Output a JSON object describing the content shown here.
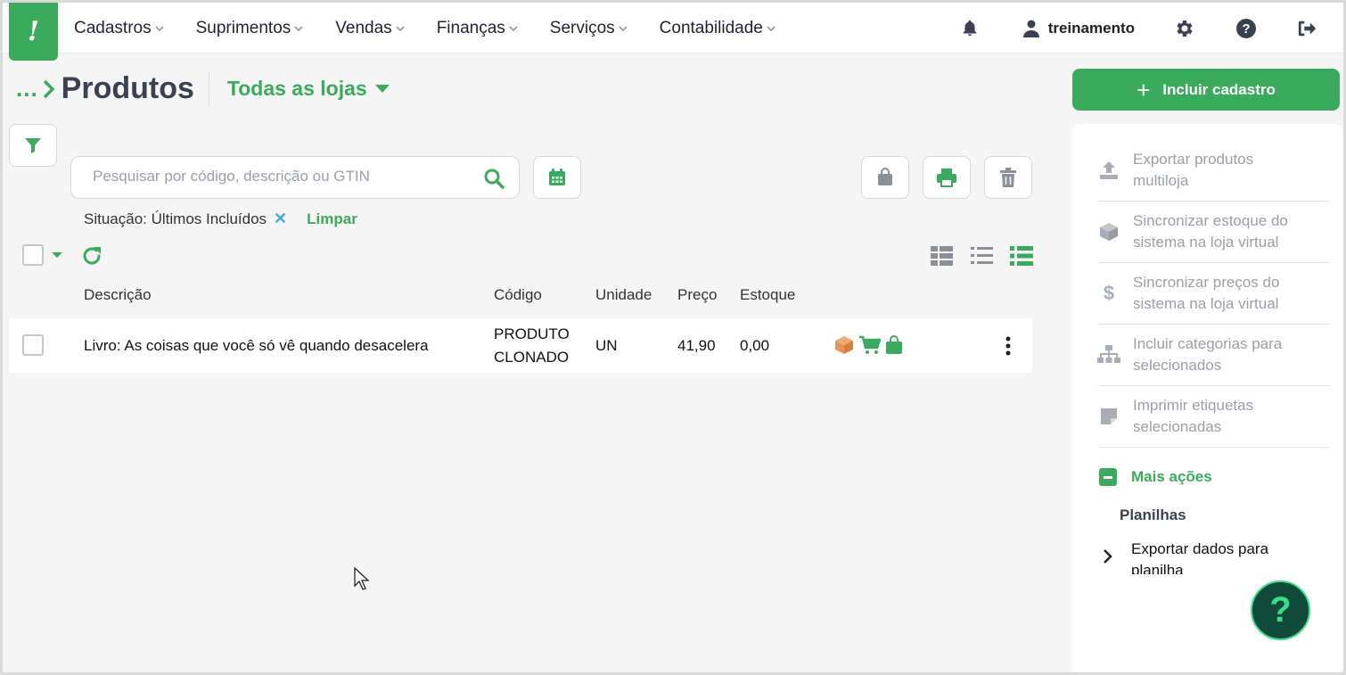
{
  "nav": {
    "logo": "!",
    "menu": [
      "Cadastros",
      "Suprimentos",
      "Vendas",
      "Finanças",
      "Serviços",
      "Contabilidade"
    ],
    "user": "treinamento",
    "icons": [
      "bell-icon",
      "user-icon",
      "gear-icon",
      "help-icon",
      "logout-icon"
    ]
  },
  "header": {
    "breadcrumb": "...",
    "title": "Produtos",
    "store_filter": "Todas as lojas"
  },
  "search": {
    "placeholder": "Pesquisar por código, descrição ou GTIN"
  },
  "filter": {
    "label": "Situação: Últimos Incluídos",
    "remove": "✕",
    "clear": "Limpar"
  },
  "table": {
    "columns": [
      "Descrição",
      "Código",
      "Unidade",
      "Preço",
      "Estoque"
    ],
    "rows": [
      {
        "descricao": "Livro: As coisas que você só vê quando desacelera",
        "codigo_line1": "PRODUTO",
        "codigo_line2": "CLONADO",
        "unidade": "UN",
        "preco": "41,90",
        "estoque": "0,00"
      }
    ]
  },
  "sidebar": {
    "add_button": "Incluir cadastro",
    "items": [
      {
        "line1": "Exportar produtos",
        "line2": "multiloja",
        "icon": "upload-icon"
      },
      {
        "line1": "Sincronizar estoque do",
        "line2": "sistema na loja virtual",
        "icon": "box-icon"
      },
      {
        "line1": "Sincronizar preços do",
        "line2": "sistema na loja virtual",
        "icon": "dollar-icon"
      },
      {
        "line1": "Incluir categorias para",
        "line2": "selecionados",
        "icon": "sitemap-icon"
      },
      {
        "line1": "Imprimir etiquetas",
        "line2": "selecionadas",
        "icon": "sticky-note-icon"
      }
    ],
    "more_actions": "Mais ações",
    "section": "Planilhas",
    "export_line1": "Exportar dados para",
    "export_line2": "planilha"
  },
  "help_fab": "?",
  "colors": {
    "brand": "#3aaa5c",
    "text_dark": "#3a4251",
    "muted": "#9aa0a8",
    "fab_bg": "#0f4a3a",
    "remove_x": "#3ea8dc",
    "box_orange": "#e8935a"
  }
}
